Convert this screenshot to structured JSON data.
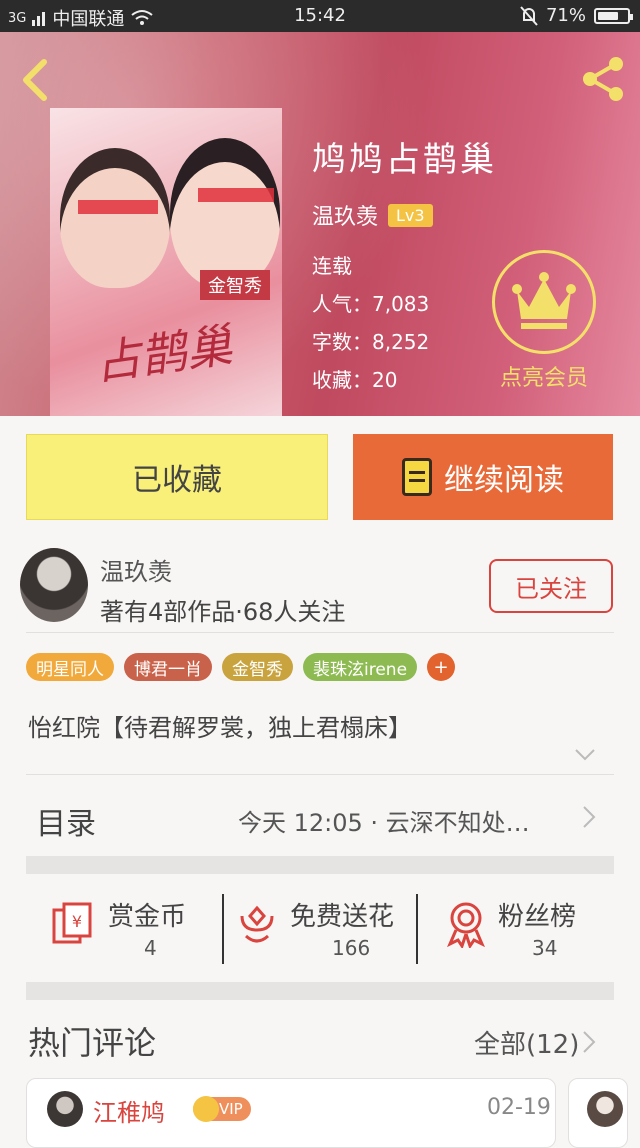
{
  "status_bar": {
    "network": "3G",
    "carrier": "中国联通",
    "time": "15:42",
    "battery": "71%",
    "battery_level": 0.71
  },
  "book": {
    "title": "鸠鸠占鹊巢",
    "author": "温玖羡",
    "level": "Lv3",
    "status": "连载",
    "popularity_label": "人气：",
    "popularity": "7,083",
    "words_label": "字数：",
    "words": "8,252",
    "favorites_label": "收藏：",
    "favorites": "20",
    "vip_label": "点亮会员",
    "cover": {
      "tag": "金智秀",
      "script": "占鹊巢"
    }
  },
  "actions": {
    "favorited_label": "已收藏",
    "continue_label": "继续阅读"
  },
  "author_block": {
    "name": "温玖羡",
    "stats": "著有4部作品·68人关注",
    "follow_label": "已关注"
  },
  "tags": [
    {
      "label": "明星同人",
      "color": "#f2a93b"
    },
    {
      "label": "博君一肖",
      "color": "#c9624a"
    },
    {
      "label": "金智秀",
      "color": "#c9a33e"
    },
    {
      "label": "裴珠泫irene",
      "color": "#8dbb52"
    }
  ],
  "tag_more": "+",
  "intro": "怡红院【待君解罗裳，独上君榻床】",
  "toc": {
    "label": "目录",
    "latest": "今天 12:05 · 云深不知处…"
  },
  "stats": [
    {
      "label": "赏金币",
      "value": "4"
    },
    {
      "label": "免费送花",
      "value": "166"
    },
    {
      "label": "粉丝榜",
      "value": "34"
    }
  ],
  "comments": {
    "title": "热门评论",
    "all_label": "全部(12)",
    "items": [
      {
        "name": "江稚鸠",
        "badge": "VIP",
        "date": "02-19"
      }
    ]
  },
  "colors": {
    "accent_orange": "#e96a39",
    "fav_yellow": "#f9f07a",
    "follow_red": "#d9443e",
    "vip_gold": "#f3e06a"
  }
}
